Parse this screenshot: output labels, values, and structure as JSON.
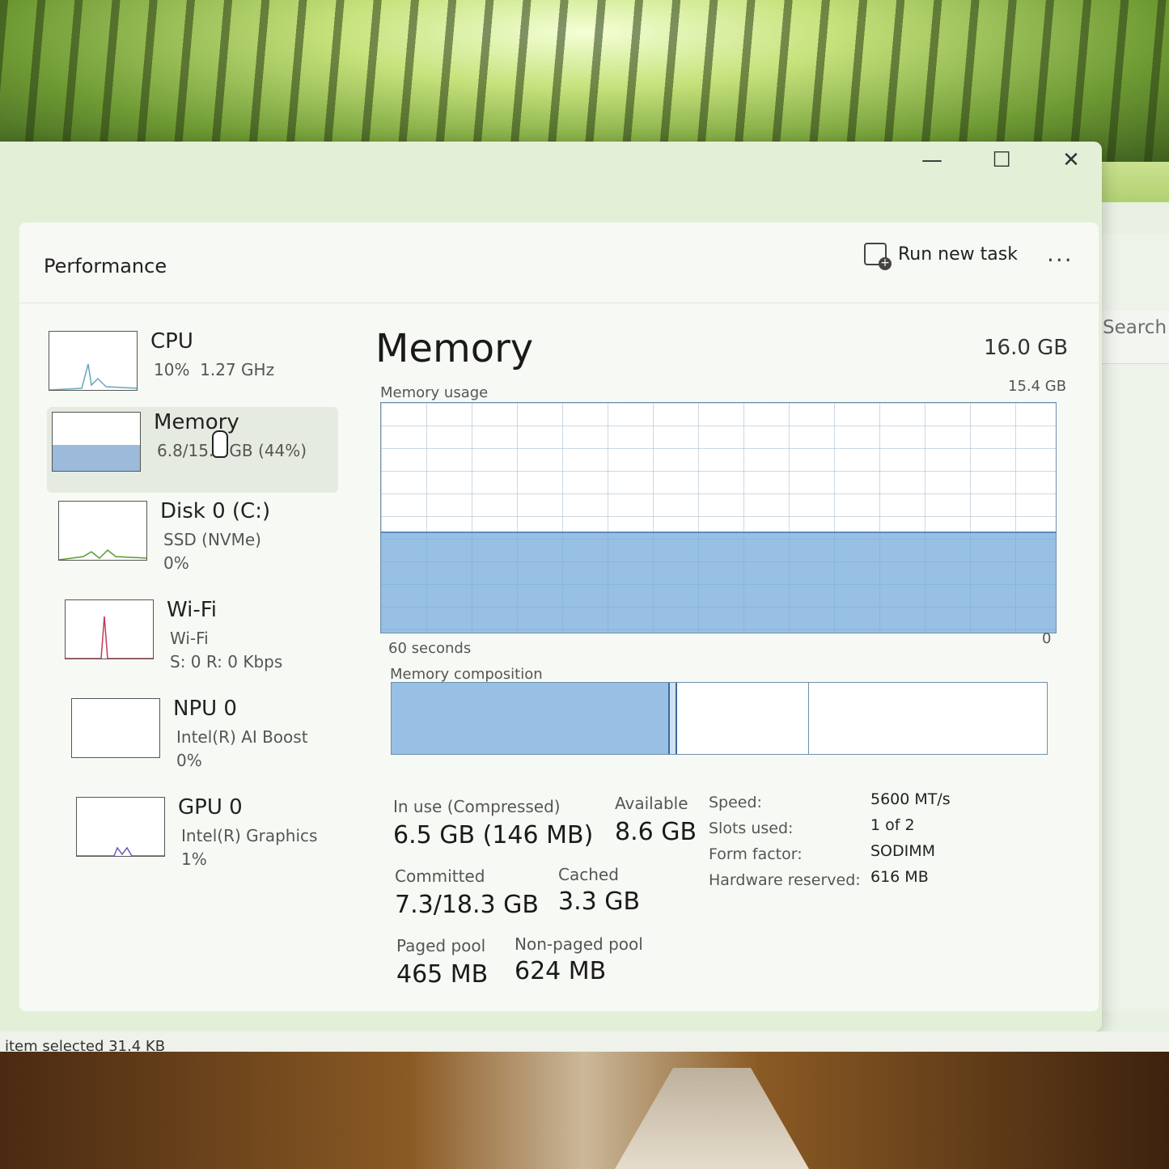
{
  "window": {
    "page_title": "Performance",
    "run_task_label": "Run new task",
    "more_label": "...",
    "minimize_glyph": "—",
    "maximize_glyph": "☐",
    "close_glyph": "✕"
  },
  "back_window": {
    "search_placeholder": "Search a",
    "status_text": "item selected  31.4 KB"
  },
  "sidebar": [
    {
      "name": "CPU",
      "sub": "10%  1.27 GHz",
      "icon": "cpu-graph-icon",
      "color": "#6aa6b8"
    },
    {
      "name": "Memory",
      "sub": "6.8/15.4 GB (44%)",
      "icon": "memory-graph-icon",
      "color": "#5a8cbf",
      "selected": true
    },
    {
      "name": "Disk 0 (C:)",
      "sub": "SSD (NVMe)\n0%",
      "icon": "disk-graph-icon",
      "color": "#5a9a2a"
    },
    {
      "name": "Wi-Fi",
      "sub": "Wi-Fi\nS: 0 R: 0 Kbps",
      "icon": "wifi-graph-icon",
      "color": "#c03a5a"
    },
    {
      "name": "NPU 0",
      "sub": "Intel(R) AI Boost\n0%",
      "icon": "npu-graph-icon",
      "color": "#7a7a7a"
    },
    {
      "name": "GPU 0",
      "sub": "Intel(R) Graphics\n1%",
      "icon": "gpu-graph-icon",
      "color": "#6a5ab8"
    }
  ],
  "main": {
    "title": "Memory",
    "total": "16.0 GB",
    "usage_label": "Memory usage",
    "usage_max": "15.4 GB",
    "time_label": "60 seconds",
    "time_end": "0",
    "composition_label": "Memory composition",
    "usage_fraction": 0.44,
    "composition": {
      "in_use": 6.5,
      "modified": 0.2,
      "standby": 3.1,
      "free": 5.6,
      "total": 15.4
    },
    "stats": {
      "in_use_label": "In use (Compressed)",
      "in_use_value": "6.5 GB (146 MB)",
      "available_label": "Available",
      "available_value": "8.6 GB",
      "committed_label": "Committed",
      "committed_value": "7.3/18.3 GB",
      "cached_label": "Cached",
      "cached_value": "3.3 GB",
      "paged_label": "Paged pool",
      "paged_value": "465 MB",
      "nonpaged_label": "Non-paged pool",
      "nonpaged_value": "624 MB"
    },
    "specs": [
      {
        "label": "Speed:",
        "value": "5600 MT/s"
      },
      {
        "label": "Slots used:",
        "value": "1 of 2"
      },
      {
        "label": "Form factor:",
        "value": "SODIMM"
      },
      {
        "label": "Hardware reserved:",
        "value": "616 MB"
      }
    ]
  },
  "colors": {
    "memory_accent": "#5a8cbf",
    "memory_fill": "#75aadb"
  }
}
